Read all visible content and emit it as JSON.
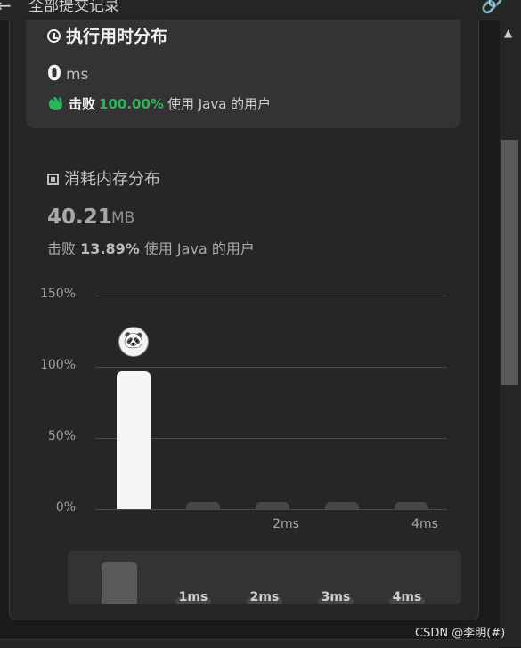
{
  "header": {
    "title": "全部提交记录",
    "back_icon": "arrow-left-icon",
    "share_icon": "link-icon"
  },
  "runtime": {
    "title": "执行用时分布",
    "value": "0",
    "unit": "ms",
    "beats_label": "击败",
    "beats_pct": "100.00%",
    "beats_suffix": "使用 Java 的用户",
    "accent": "#2db55d"
  },
  "memory": {
    "title": "消耗内存分布",
    "value": "40.21",
    "unit": "MB",
    "beats_label": "击败",
    "beats_pct": "13.89%",
    "beats_suffix": "使用 Java 的用户"
  },
  "chart_data": {
    "type": "bar",
    "categories": [
      "0ms",
      "1ms",
      "2ms",
      "3ms",
      "4ms"
    ],
    "values": [
      97,
      2,
      2,
      2,
      2
    ],
    "ylim": [
      0,
      150
    ],
    "yticks": [
      "150%",
      "100%",
      "50%",
      "0%"
    ],
    "xtick_labels": [
      "",
      "",
      "2ms",
      "",
      "4ms"
    ],
    "highlight_index": 0,
    "colors": {
      "highlight": "#f5f5f5",
      "other": "#474747",
      "grid": "#4a4a4a"
    }
  },
  "mini_axis": {
    "labels": [
      "1ms",
      "2ms",
      "3ms",
      "4ms"
    ]
  },
  "watermark": "CSDN @李明(#)"
}
